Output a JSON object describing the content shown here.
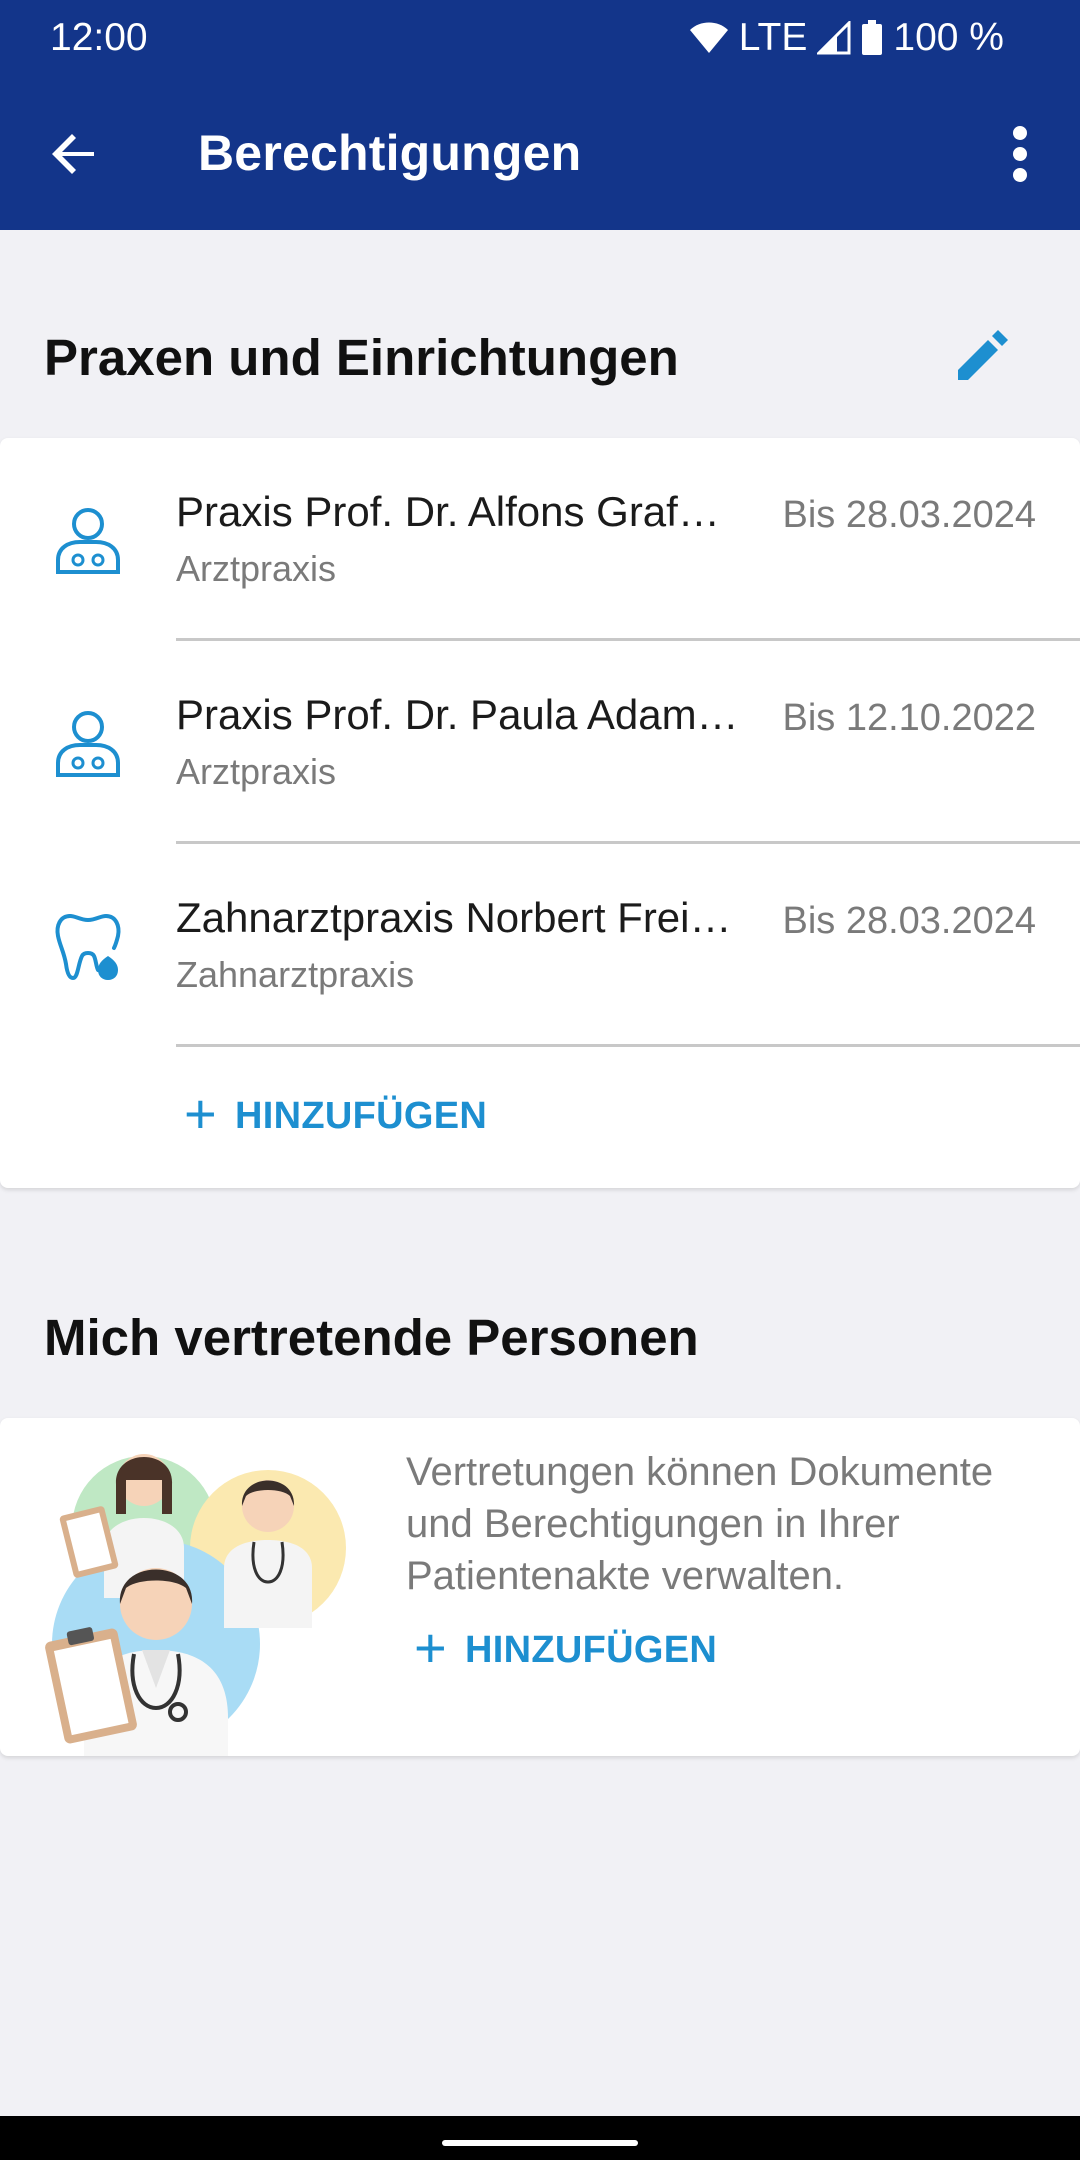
{
  "status": {
    "time": "12:00",
    "network": "LTE",
    "battery": "100 %",
    "icons": [
      "wifi-icon",
      "signal-icon",
      "battery-icon"
    ]
  },
  "appbar": {
    "title": "Berechtigungen",
    "back_icon": "arrow-back-icon",
    "more_icon": "more-vert-icon"
  },
  "practices": {
    "title": "Praxen und Einrichtungen",
    "edit_icon": "pencil-icon",
    "items": [
      {
        "name": "Praxis Prof. Dr. Alfons Graf…",
        "type": "Arztpraxis",
        "until": "Bis 28.03.2024",
        "icon": "doctor-icon"
      },
      {
        "name": "Praxis Prof. Dr. Paula Adam…",
        "type": "Arztpraxis",
        "until": "Bis 12.10.2022",
        "icon": "doctor-icon"
      },
      {
        "name": "Zahnarztpraxis Norbert Frei…",
        "type": "Zahnarztpraxis",
        "until": "Bis 28.03.2024",
        "icon": "tooth-icon"
      }
    ],
    "add_label": "HINZUFÜGEN"
  },
  "representatives": {
    "title": "Mich vertretende Personen",
    "description": "Vertretungen können Dokumente und Berechtigungen in Ihrer Patientenakte verwalten.",
    "add_label": "HINZUFÜGEN",
    "illustration": "doctors-illustration"
  },
  "colors": {
    "primary": "#13358a",
    "accent": "#1d8fd0",
    "background": "#f1f1f5"
  }
}
